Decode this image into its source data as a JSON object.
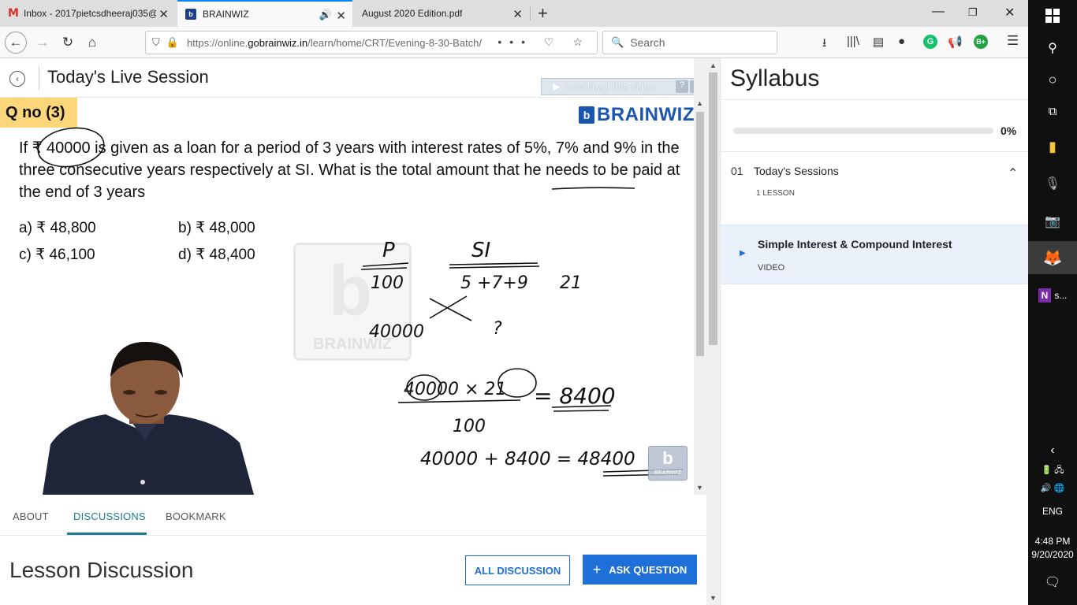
{
  "browser": {
    "tabs": [
      {
        "title": "Inbox - 2017pietcsdheeraj035@",
        "icon": "gmail-icon"
      },
      {
        "title": "BRAINWIZ",
        "icon": "brainwiz-favicon",
        "audio": true,
        "active": true
      },
      {
        "title": "August 2020 Edition.pdf",
        "icon": "pdf-icon"
      }
    ],
    "new_tab": "+",
    "url_prefix": "https://online.",
    "url_domain": "gobrainwiz.in",
    "url_path": "/learn/home/CRT/Evening-8-30-Batch/",
    "search_placeholder": "Search",
    "more": "•••"
  },
  "session": {
    "title": "Today's Live Session",
    "download_label": "Download this video",
    "help": "?",
    "close": "X"
  },
  "slide": {
    "qno": "Q no (3)",
    "logo_text": "BRAINWIZ",
    "logo_mark": "b",
    "question": "If ₹ 40000 is given as a loan for a period of 3 years with interest rates of 5%, 7% and 9% in the three consecutive years respectively at SI. What is the total amount that he needs to be paid at the end of 3 years",
    "options": [
      {
        "label": "a) ₹ 48,800"
      },
      {
        "label": "b) ₹ 48,000"
      },
      {
        "label": "c) ₹ 46,100"
      },
      {
        "label": "d) ₹ 48,400"
      }
    ],
    "watermark": "BRAINWIZ",
    "mini_logo": "BRAINWIZ",
    "handwriting": {
      "p": "P",
      "si": "SI",
      "hundred": "100",
      "rates": "5 +7+9",
      "twentyone": "21",
      "forty": "40000",
      "question": "?",
      "calc": "40000 × 21",
      "eq1": "= 8400",
      "denom": "100",
      "final": "40000 + 8400 = 48400"
    }
  },
  "content_tabs": [
    {
      "label": "ABOUT",
      "active": false
    },
    {
      "label": "DISCUSSIONS",
      "active": true
    },
    {
      "label": "BOOKMARK",
      "active": false
    }
  ],
  "discussion": {
    "title": "Lesson Discussion",
    "all_label": "ALL DISCUSSION",
    "ask_label": "ASK QUESTION",
    "ask_icon": "+"
  },
  "syllabus": {
    "title": "Syllabus",
    "progress": 0,
    "progress_label": "0%",
    "section": {
      "number": "01",
      "title": "Today's Sessions",
      "count": "1 LESSON"
    },
    "lesson": {
      "title": "Simple Interest & Compound Interest",
      "type": "VIDEO"
    }
  },
  "taskbar": {
    "onenote_label": "s...",
    "lang": "ENG",
    "time": "4:48 PM",
    "date": "9/20/2020"
  },
  "colors": {
    "accent": "#1f6fd8",
    "teal": "#1c7b8f",
    "qno_bg": "#fbd67b"
  }
}
